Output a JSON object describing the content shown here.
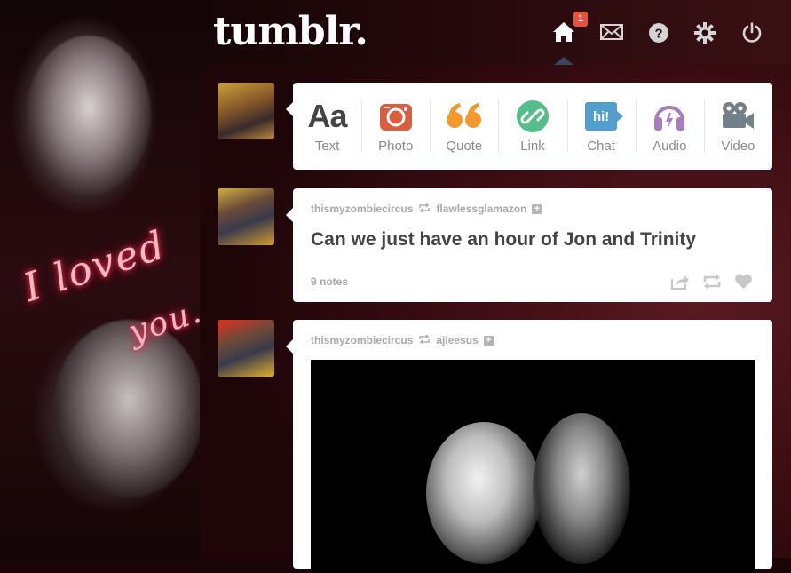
{
  "app": {
    "logo_text": "tumblr."
  },
  "nav": {
    "items": [
      {
        "name": "home",
        "icon": "home-icon"
      },
      {
        "name": "messages",
        "icon": "envelope-icon"
      },
      {
        "name": "help",
        "icon": "help-icon"
      },
      {
        "name": "settings",
        "icon": "gear-icon"
      },
      {
        "name": "logout",
        "icon": "power-icon"
      }
    ],
    "home_badge": "1"
  },
  "background": {
    "script_line1": "I loved",
    "script_line2": "you..!"
  },
  "post_types": [
    {
      "label": "Text",
      "icon": "text-icon",
      "glyph": "Aa",
      "color": "#444444"
    },
    {
      "label": "Photo",
      "icon": "camera-icon",
      "color": "#d95e40"
    },
    {
      "label": "Quote",
      "icon": "quote-icon",
      "color": "#f2992e"
    },
    {
      "label": "Link",
      "icon": "link-icon",
      "color": "#56bc8a"
    },
    {
      "label": "Chat",
      "icon": "chat-icon",
      "glyph": "hi!",
      "color": "#529ecc"
    },
    {
      "label": "Audio",
      "icon": "headphones-icon",
      "color": "#a77dc2"
    },
    {
      "label": "Video",
      "icon": "video-camera-icon",
      "color": "#748089"
    }
  ],
  "posts": [
    {
      "author": "thismyzombiecircus",
      "reblogged_from": "flawlessglamazon",
      "title": "Can we just have an hour of Jon and Trinity",
      "notes": "9 notes"
    },
    {
      "author": "thismyzombiecircus",
      "reblogged_from": "ajleesus"
    }
  ],
  "colors": {
    "accent_blue": "#36465d",
    "badge_red": "#e5533b"
  }
}
